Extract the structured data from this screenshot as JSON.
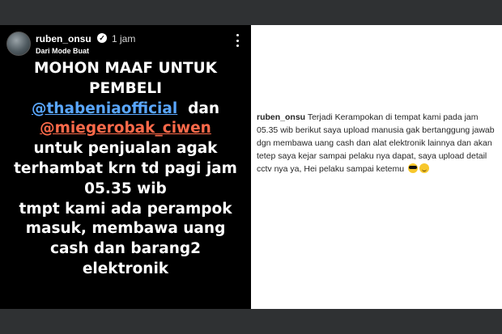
{
  "story": {
    "username": "ruben_onsu",
    "time": "1 jam",
    "subtitle": "Dari Mode Buat",
    "lines": [
      "MOHON MAAF UNTUK",
      "PEMBELI",
      "@thabeniaofficial",
      "dan",
      "@miegerobak_ciwen",
      "untuk penjualan agak",
      "terhambat krn td pagi jam",
      "05.35 wib",
      "tmpt kami ada perampok",
      "masuk, membawa uang",
      "cash dan  barang2",
      "elektronik"
    ],
    "colors": {
      "mention1": "#5aa7ff",
      "mention2": "#ff6a4a",
      "background": "#000000"
    }
  },
  "caption": {
    "username": "ruben_onsu",
    "text": "Terjadi Kerampokan di tempat kami pada jam 05.35 wib berikut saya upload manusia gak bertanggung jawab dgn membawa uang cash dan alat elektronik lainnya dan akan tetep saya kejar sampai pelaku nya dapat, saya upload detail cctv nya ya, Hei pelaku sampai ketemu",
    "emojis": [
      "sunglasses-emoji",
      "smiling-face-emoji"
    ]
  },
  "icons": {
    "verified": "verified-badge-icon",
    "menu": "more-vertical-icon"
  }
}
